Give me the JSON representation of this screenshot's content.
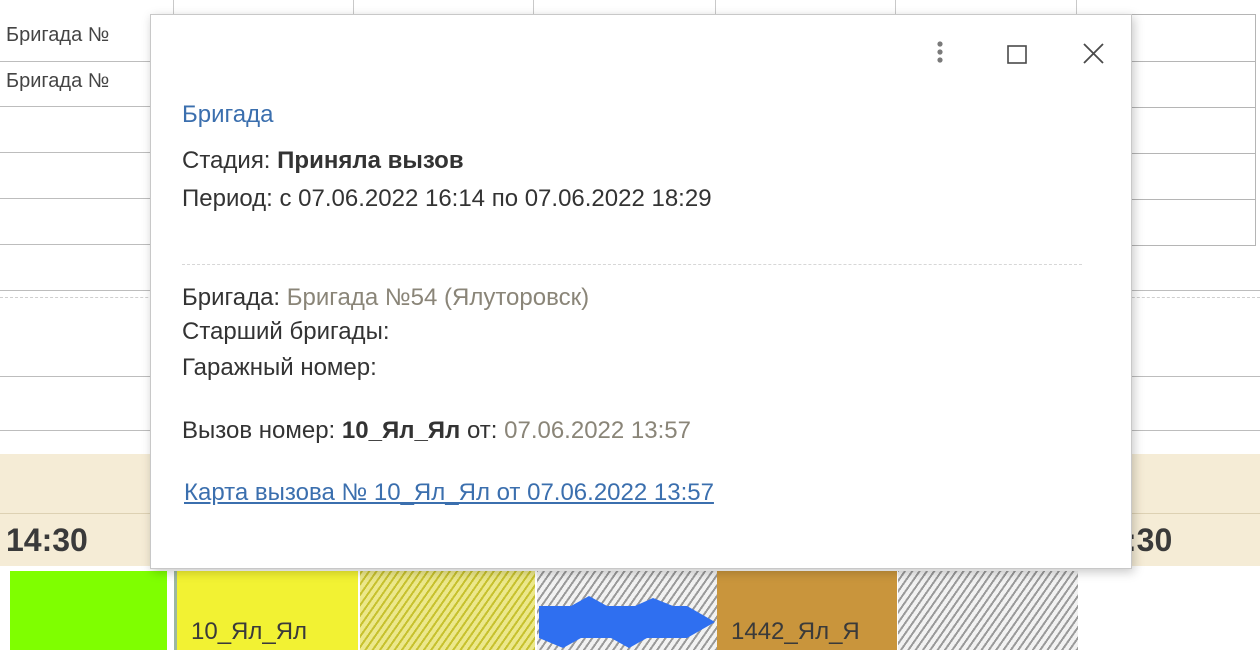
{
  "background": {
    "row_labels": [
      "Бригада №",
      "Бригада №"
    ],
    "time_left": "14:30",
    "time_right": ":30",
    "bars": [
      {
        "text": ""
      },
      {
        "text": "10_Ял_Ял"
      },
      {
        "text": ""
      },
      {
        "text": ""
      },
      {
        "text": "1442_Ял_Я"
      },
      {
        "text": ""
      }
    ],
    "colors": {
      "green": "#7fff00",
      "yellow": "#f2f233",
      "brown": "#c9953c",
      "arrow_blue": "#2f6ff0",
      "time_band": "#f5ecd6"
    }
  },
  "popup": {
    "title": "Бригада",
    "stage_label": "Стадия:",
    "stage_value": "Приняла вызов",
    "period_text": "Период: с 07.06.2022 16:14 по 07.06.2022 18:29",
    "brigade_label": "Бригада:",
    "brigade_value": "Бригада №54 (Ялуторовск)",
    "senior_label": "Старший бригады:",
    "garage_label": "Гаражный номер:",
    "call_label": "Вызов номер:",
    "call_number": "10_Ял_Ял",
    "call_from_label": "от:",
    "call_datetime": "07.06.2022 13:57",
    "card_link": "Карта вызова № 10_Ял_Ял от 07.06.2022 13:57",
    "controls": {
      "more_icon": "kebab-vertical",
      "maximize_icon": "square-outline",
      "close_icon": "x-cross"
    }
  }
}
